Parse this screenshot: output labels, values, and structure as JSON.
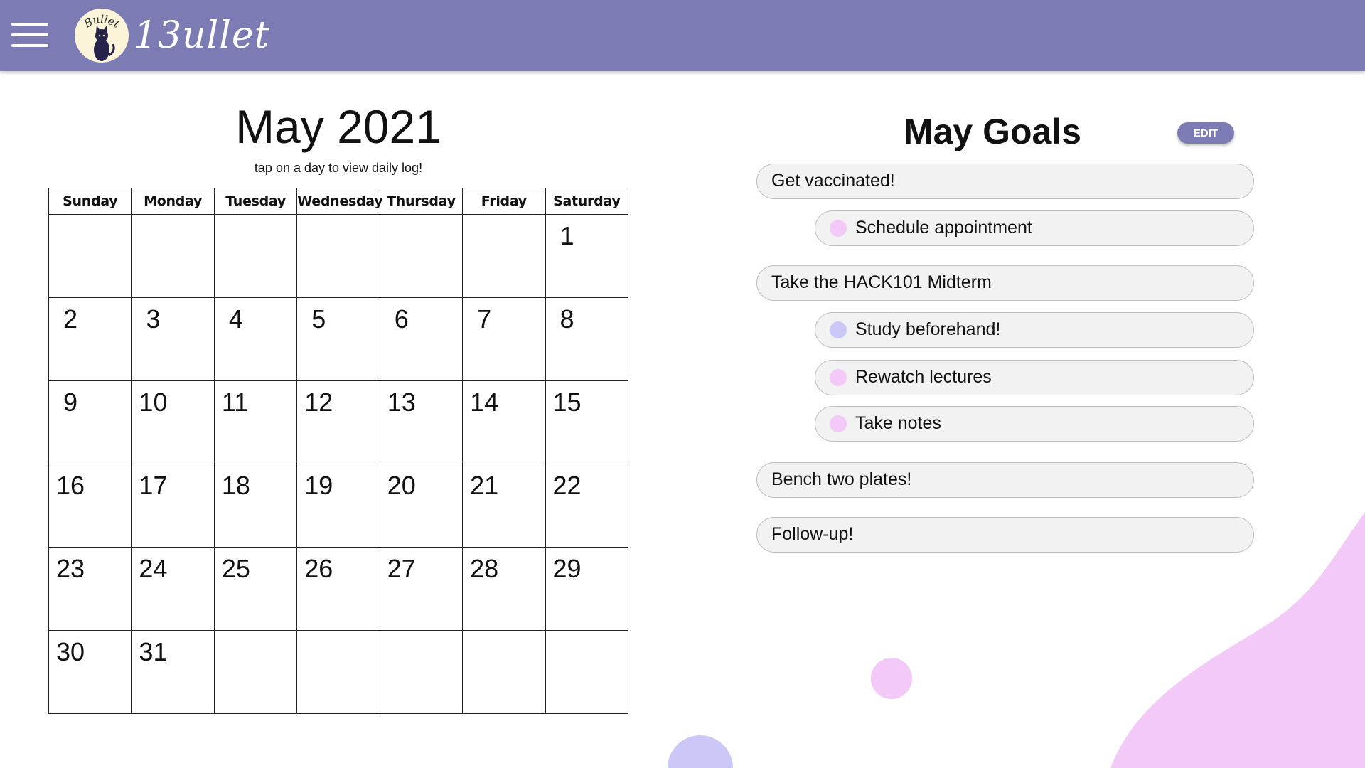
{
  "app": {
    "logo_text": "Bullet",
    "logo_brand": "13ullet",
    "brand_color": "#7c7bb4"
  },
  "calendar": {
    "title": "May 2021",
    "hint": "tap on a day to view daily log!",
    "weekdays": [
      "Sunday",
      "Monday",
      "Tuesday",
      "Wednesday",
      "Thursday",
      "Friday",
      "Saturday"
    ],
    "weeks": [
      [
        "",
        "",
        "",
        "",
        "",
        "",
        "1"
      ],
      [
        "2",
        "3",
        "4",
        "5",
        "6",
        "7",
        "8"
      ],
      [
        "9",
        "10",
        "11",
        "12",
        "13",
        "14",
        "15"
      ],
      [
        "16",
        "17",
        "18",
        "19",
        "20",
        "21",
        "22"
      ],
      [
        "23",
        "24",
        "25",
        "26",
        "27",
        "28",
        "29"
      ],
      [
        "30",
        "31",
        "",
        "",
        "",
        "",
        ""
      ]
    ]
  },
  "goals": {
    "title": "May Goals",
    "edit_label": "EDIT",
    "items": [
      {
        "label": "Get vaccinated!",
        "level": "main"
      },
      {
        "label": "Schedule appointment",
        "level": "sub",
        "dot_color": "#f2c9f7"
      },
      {
        "label": "Take the HACK101 Midterm",
        "level": "main"
      },
      {
        "label": "Study beforehand!",
        "level": "sub",
        "dot_color": "#cbc8f7"
      },
      {
        "label": "Rewatch lectures",
        "level": "sub",
        "dot_color": "#f2c9f7"
      },
      {
        "label": "Take notes",
        "level": "sub",
        "dot_color": "#f2c9f7"
      },
      {
        "label": "Bench two plates!",
        "level": "main"
      },
      {
        "label": "Follow-up!",
        "level": "main"
      }
    ]
  },
  "colors": {
    "pink_blob": "#f2c9f7",
    "lavender_blob": "#cbc8f7"
  }
}
